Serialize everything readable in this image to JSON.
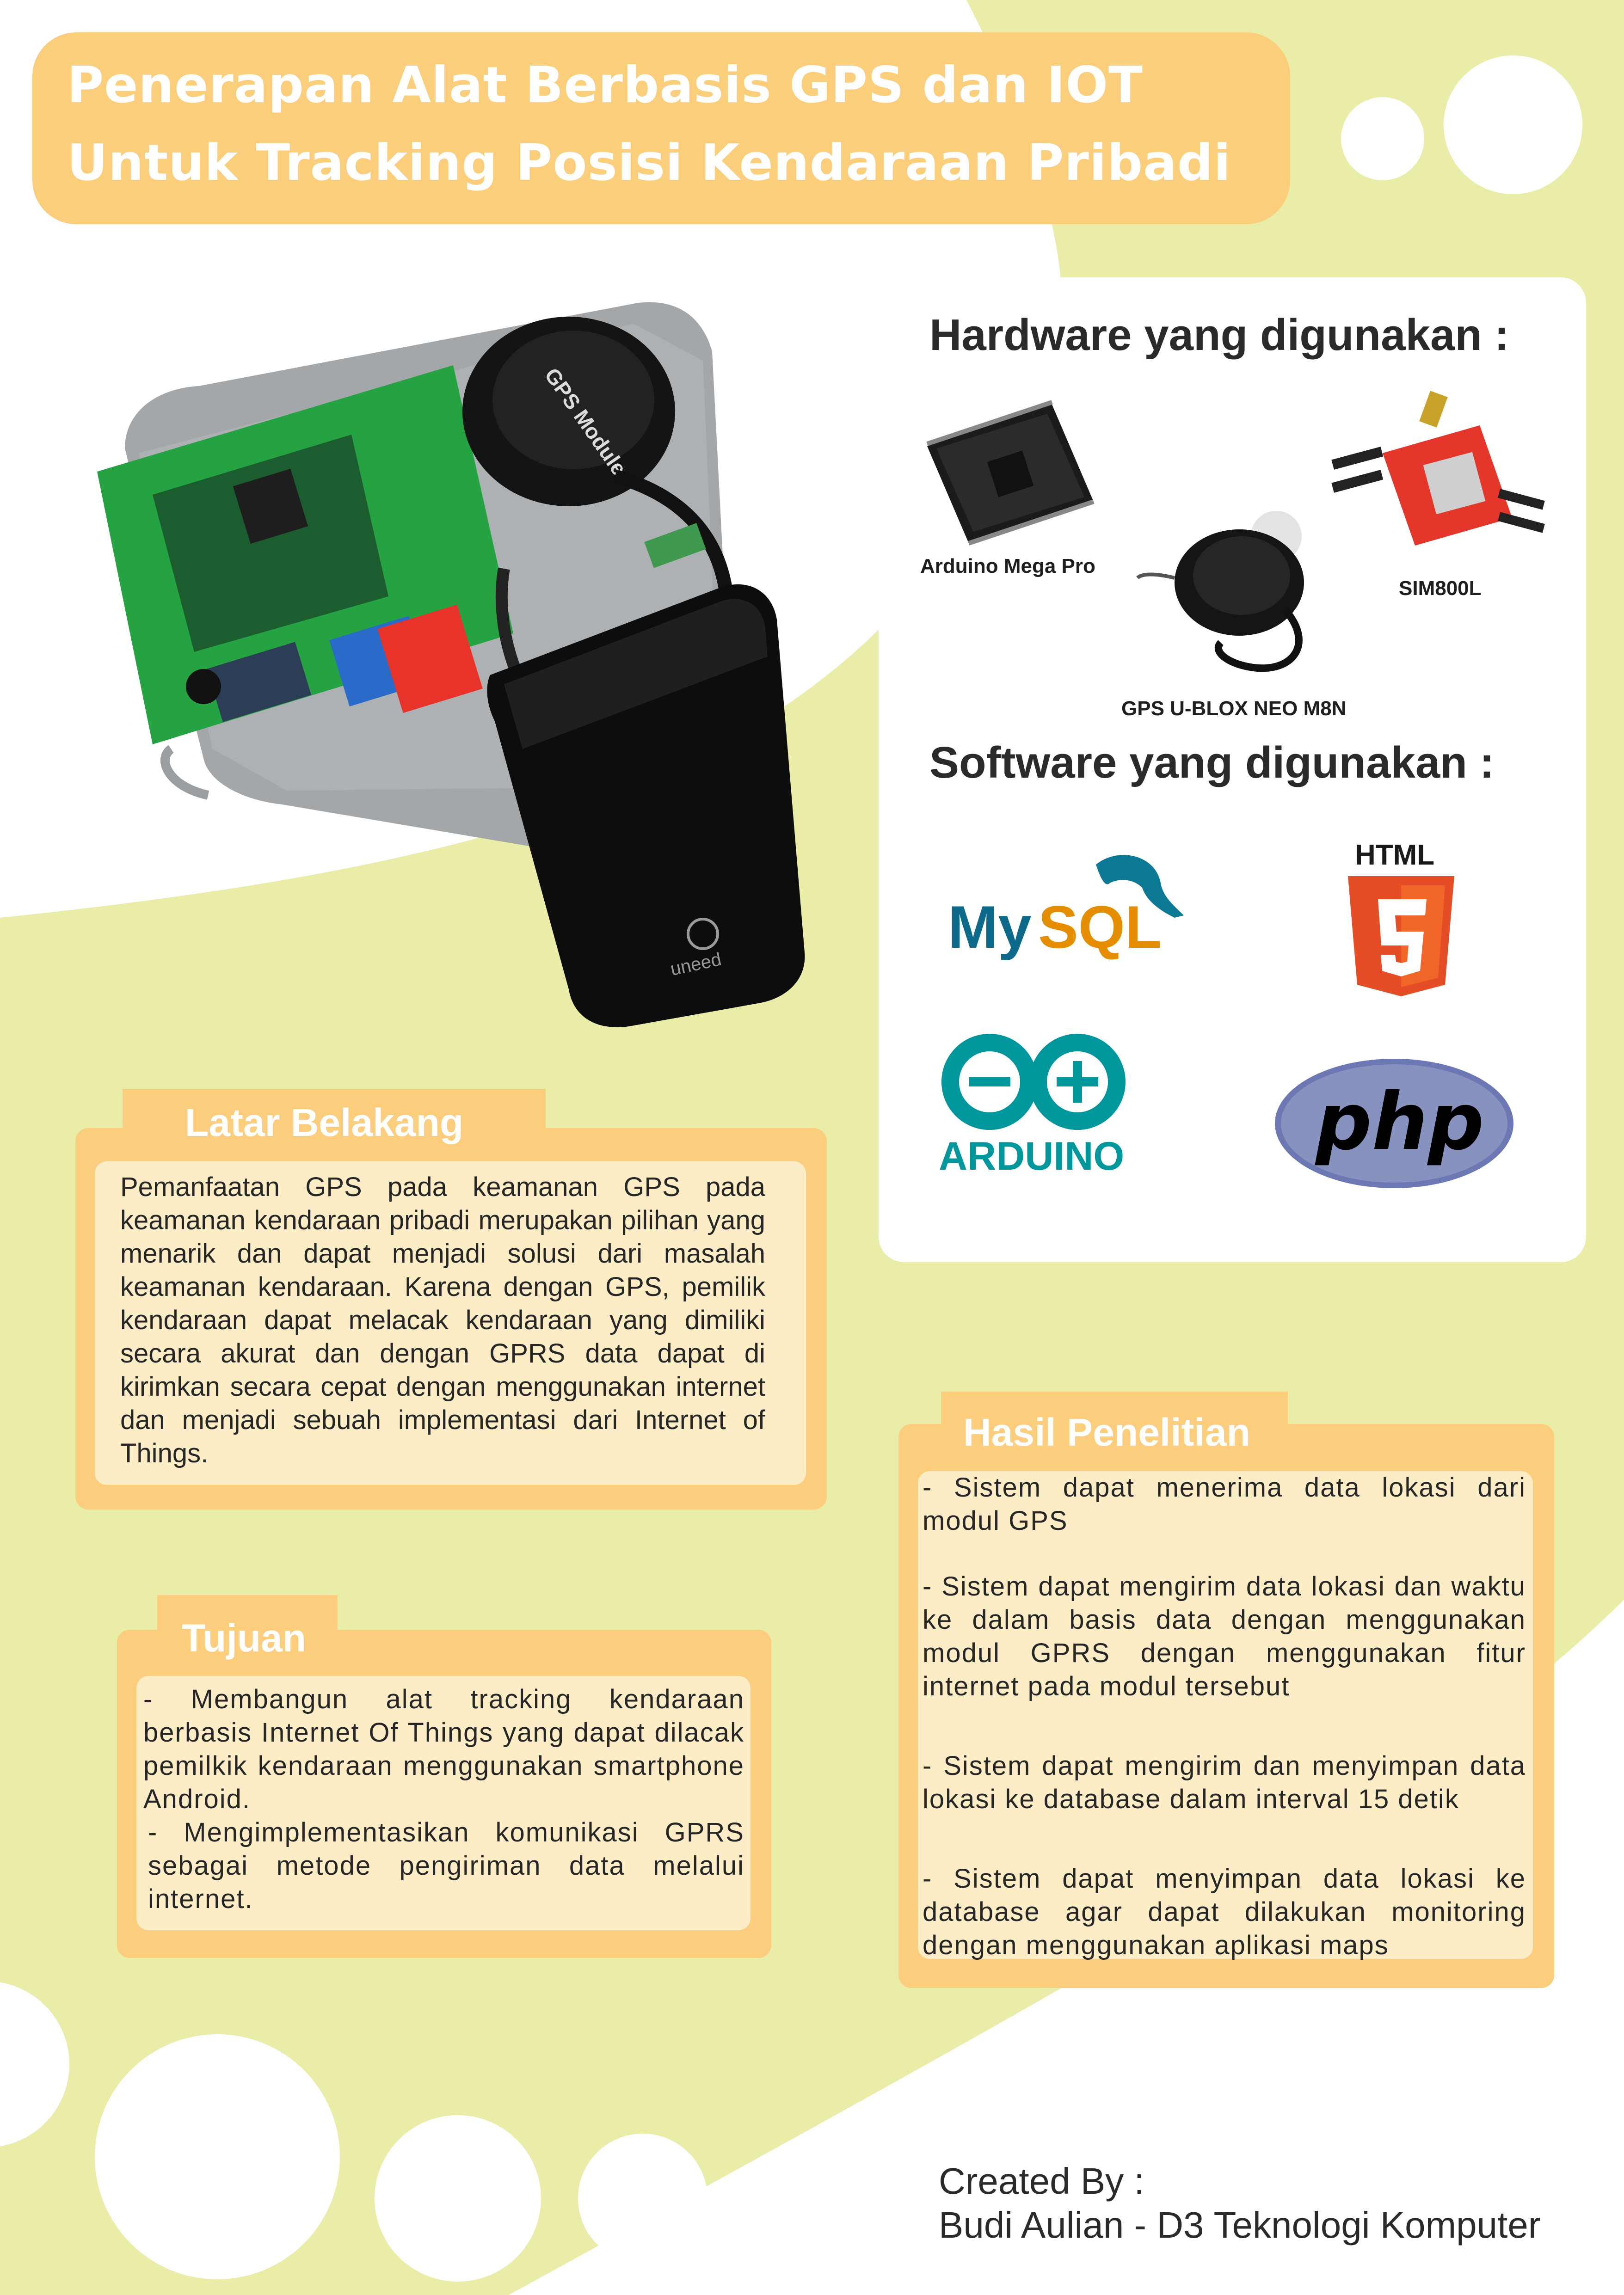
{
  "title": {
    "line1": "Penerapan Alat Berbasis GPS dan IOT",
    "line2": "Untuk Tracking Posisi Kendaraan Pribadi"
  },
  "hardware": {
    "heading": "Hardware yang digunakan :",
    "items": [
      {
        "label": "Arduino Mega Pro",
        "icon": "arduino-mega-pro-board-icon"
      },
      {
        "label": "SIM800L",
        "icon": "sim800l-module-icon"
      },
      {
        "label": "GPS U-BLOX NEO M8N",
        "icon": "gps-ublox-antenna-icon"
      }
    ]
  },
  "software": {
    "heading": "Software yang digunakan :",
    "logos": [
      {
        "text": "MySQL",
        "icon": "mysql-logo"
      },
      {
        "text": "HTML",
        "icon": "html5-logo"
      },
      {
        "text": "ARDUINO",
        "icon": "arduino-logo"
      },
      {
        "text": "php",
        "icon": "php-logo"
      }
    ]
  },
  "hero": {
    "icon": "gps-tracker-device-photo",
    "brand": "uneed",
    "gps_module_text": "GPS Module"
  },
  "latar_belakang": {
    "heading": "Latar Belakang",
    "body": "Pemanfaatan GPS pada keamanan GPS pada keamanan kendaraan pribadi merupakan pilihan yang menarik dan dapat menjadi solusi dari masalah keamanan kendaraan. Karena dengan GPS, pemilik kendaraan dapat melacak kendaraan yang dimiliki secara akurat dan dengan GPRS data dapat di kirimkan secara cepat dengan menggunakan internet dan menjadi sebuah implementasi dari Internet of Things."
  },
  "tujuan": {
    "heading": "Tujuan",
    "items": [
      "- Membangun alat tracking kendaraan berbasis Internet Of Things yang dapat dilacak pemilkik kendaraan menggunakan smartphone Android.",
      "- Mengimplementasikan komunikasi GPRS sebagai metode pengiriman data melalui internet."
    ]
  },
  "hasil": {
    "heading": "Hasil Penelitian",
    "items": [
      "- Sistem dapat menerima data lokasi dari modul GPS",
      "- Sistem dapat mengirim data lokasi dan waktu ke dalam basis data dengan menggunakan modul GPRS dengan menggunakan fitur internet pada modul tersebut",
      "- Sistem dapat mengirim dan menyimpan data lokasi ke database dalam interval 15 detik",
      "- Sistem dapat menyimpan data lokasi ke database agar dapat dilakukan monitoring dengan menggunakan aplikasi maps"
    ]
  },
  "footer": {
    "line1": "Created By :",
    "line2": "Budi Aulian - D3 Teknologi Komputer"
  },
  "colors": {
    "background_green": "#e9eda7",
    "orange": "#fbcd7d",
    "cream": "#fdedc7",
    "white": "#ffffff"
  }
}
